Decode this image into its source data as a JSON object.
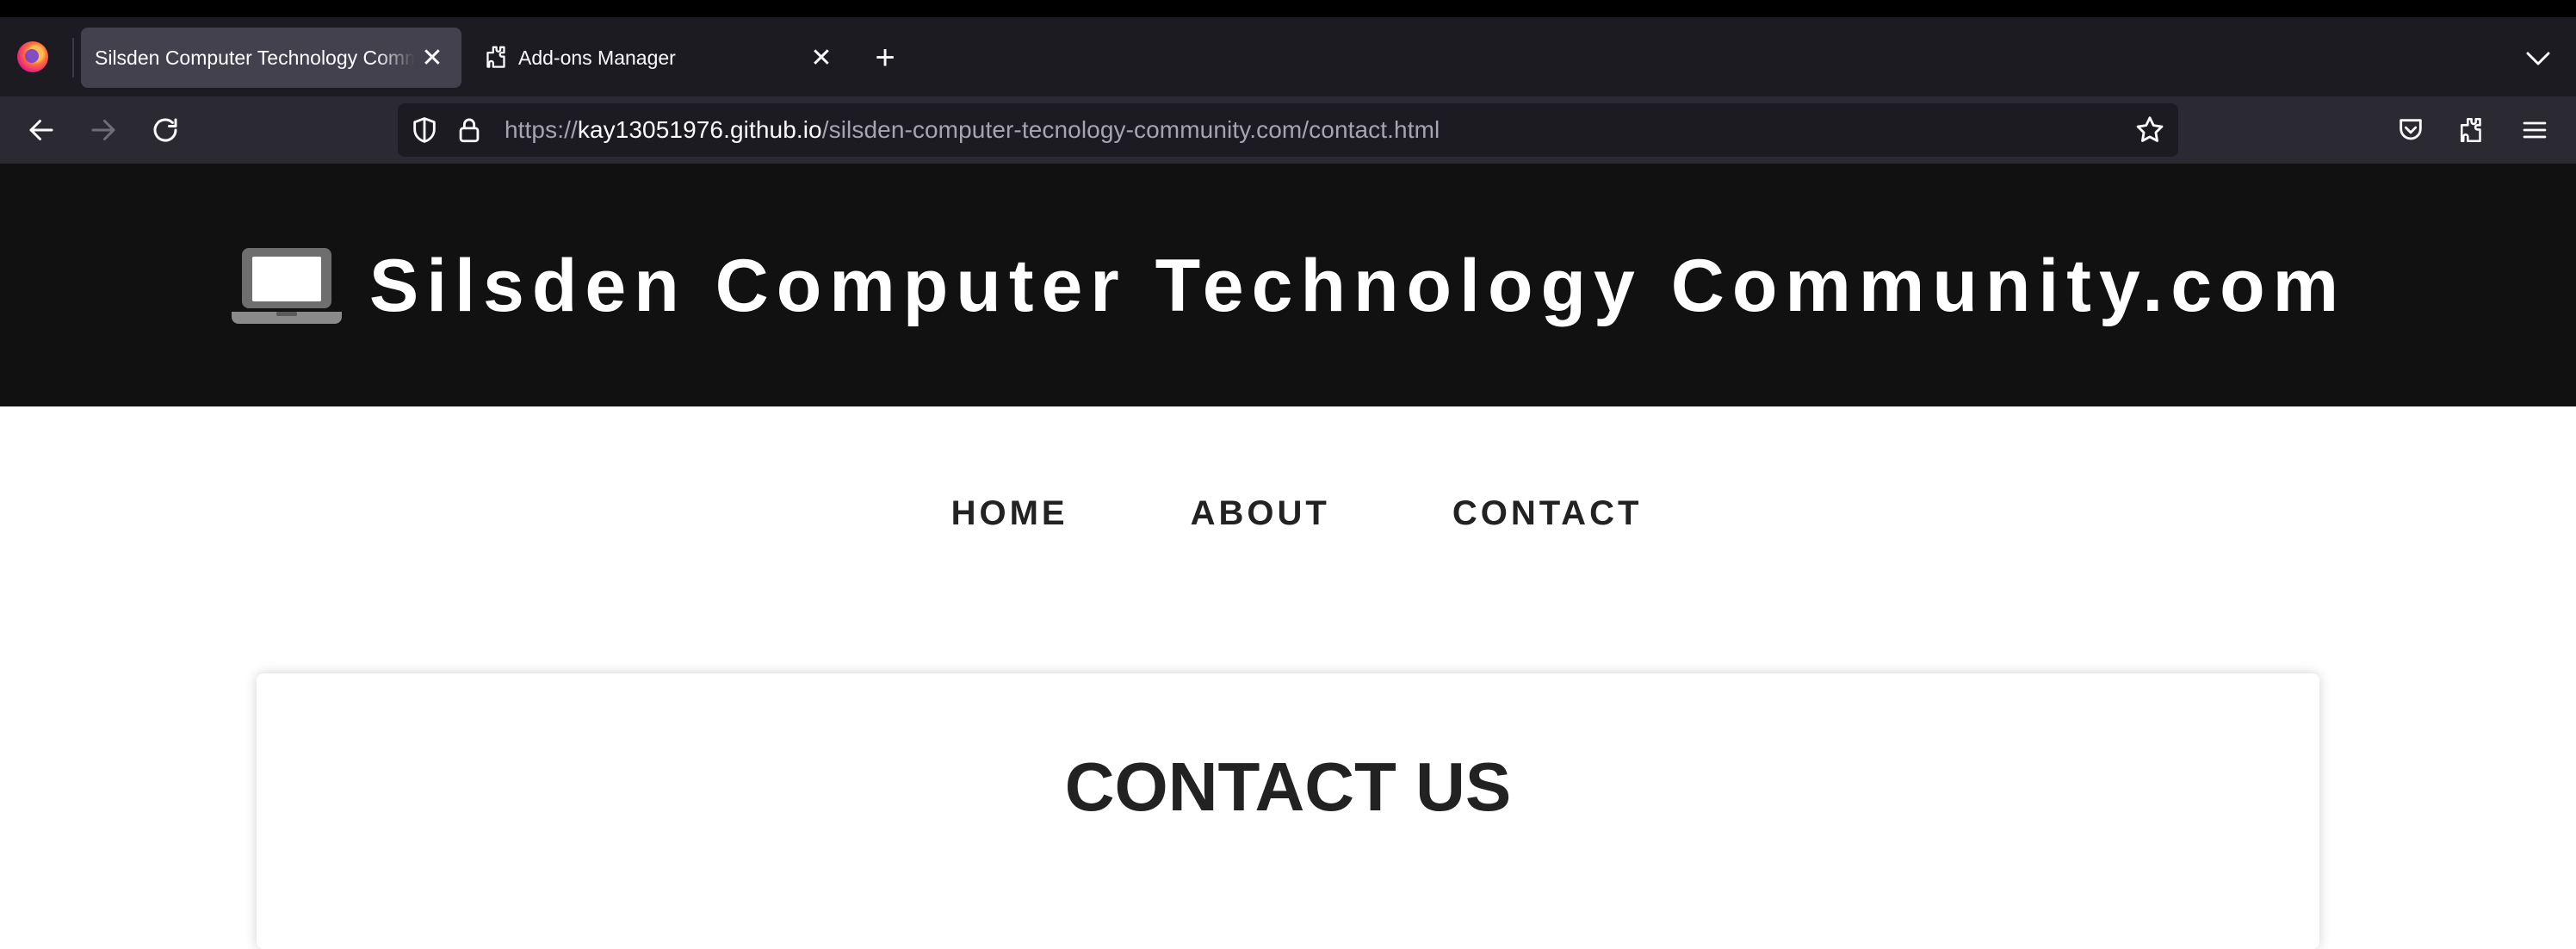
{
  "browser": {
    "tabs": [
      {
        "title": "Silsden Computer Technology Community.com",
        "active": true
      },
      {
        "title": "Add-ons Manager",
        "active": false
      }
    ],
    "new_tab_symbol": "+",
    "close_symbol": "✕",
    "url": {
      "scheme": "https://",
      "host": "kay13051976.github.io",
      "path": "/silsden-computer-tecnology-community.com/contact.html"
    },
    "icons": [
      "back-arrow-icon",
      "forward-arrow-icon",
      "reload-icon",
      "shield-icon",
      "lock-icon",
      "bookmark-star-icon",
      "pocket-icon",
      "extensions-icon",
      "menu-icon",
      "tab-list-chevron-icon"
    ]
  },
  "site": {
    "title": "Silsden Computer Technology Community.com",
    "logo_icon": "laptop-icon",
    "nav": [
      {
        "label": "HOME"
      },
      {
        "label": "ABOUT"
      },
      {
        "label": "CONTACT"
      }
    ],
    "heading": "CONTACT US"
  },
  "colors": {
    "chrome_bg": "#1c1b22",
    "toolbar_bg": "#2b2a33",
    "header_bg": "#111111",
    "text_dark": "#222222"
  }
}
